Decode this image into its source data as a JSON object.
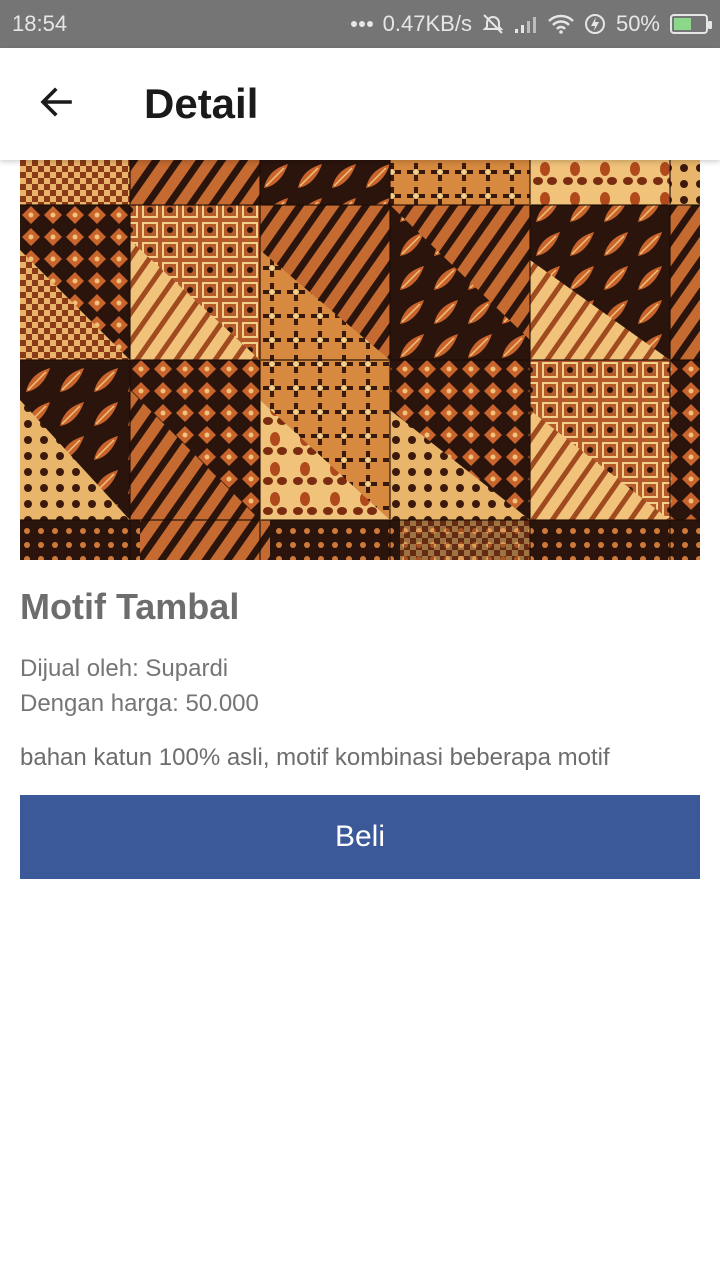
{
  "status_bar": {
    "time": "18:54",
    "network_speed": "0.47KB/s",
    "battery": "50%",
    "battery_level": 0.5,
    "icons": [
      "dots-icon",
      "alarm-off-icon",
      "signal-icon",
      "wifi-icon",
      "charging-icon",
      "battery-icon"
    ]
  },
  "app_bar": {
    "title": "Detail",
    "back_icon": "arrow-back-icon"
  },
  "product": {
    "name": "Motif Tambal",
    "seller": "Dijual oleh: Supardi",
    "price": "Dengan harga: 50.000",
    "description": "bahan katun 100% asli, motif kombinasi beberapa motif",
    "buy_label": "Beli",
    "image_alt": "batik-tambal-image"
  },
  "colors": {
    "status_bar": "#757575",
    "button": "#3b5998",
    "batik_dark": "#2a140c",
    "batik_mid": "#b55a2a",
    "batik_light": "#f0c27a"
  }
}
